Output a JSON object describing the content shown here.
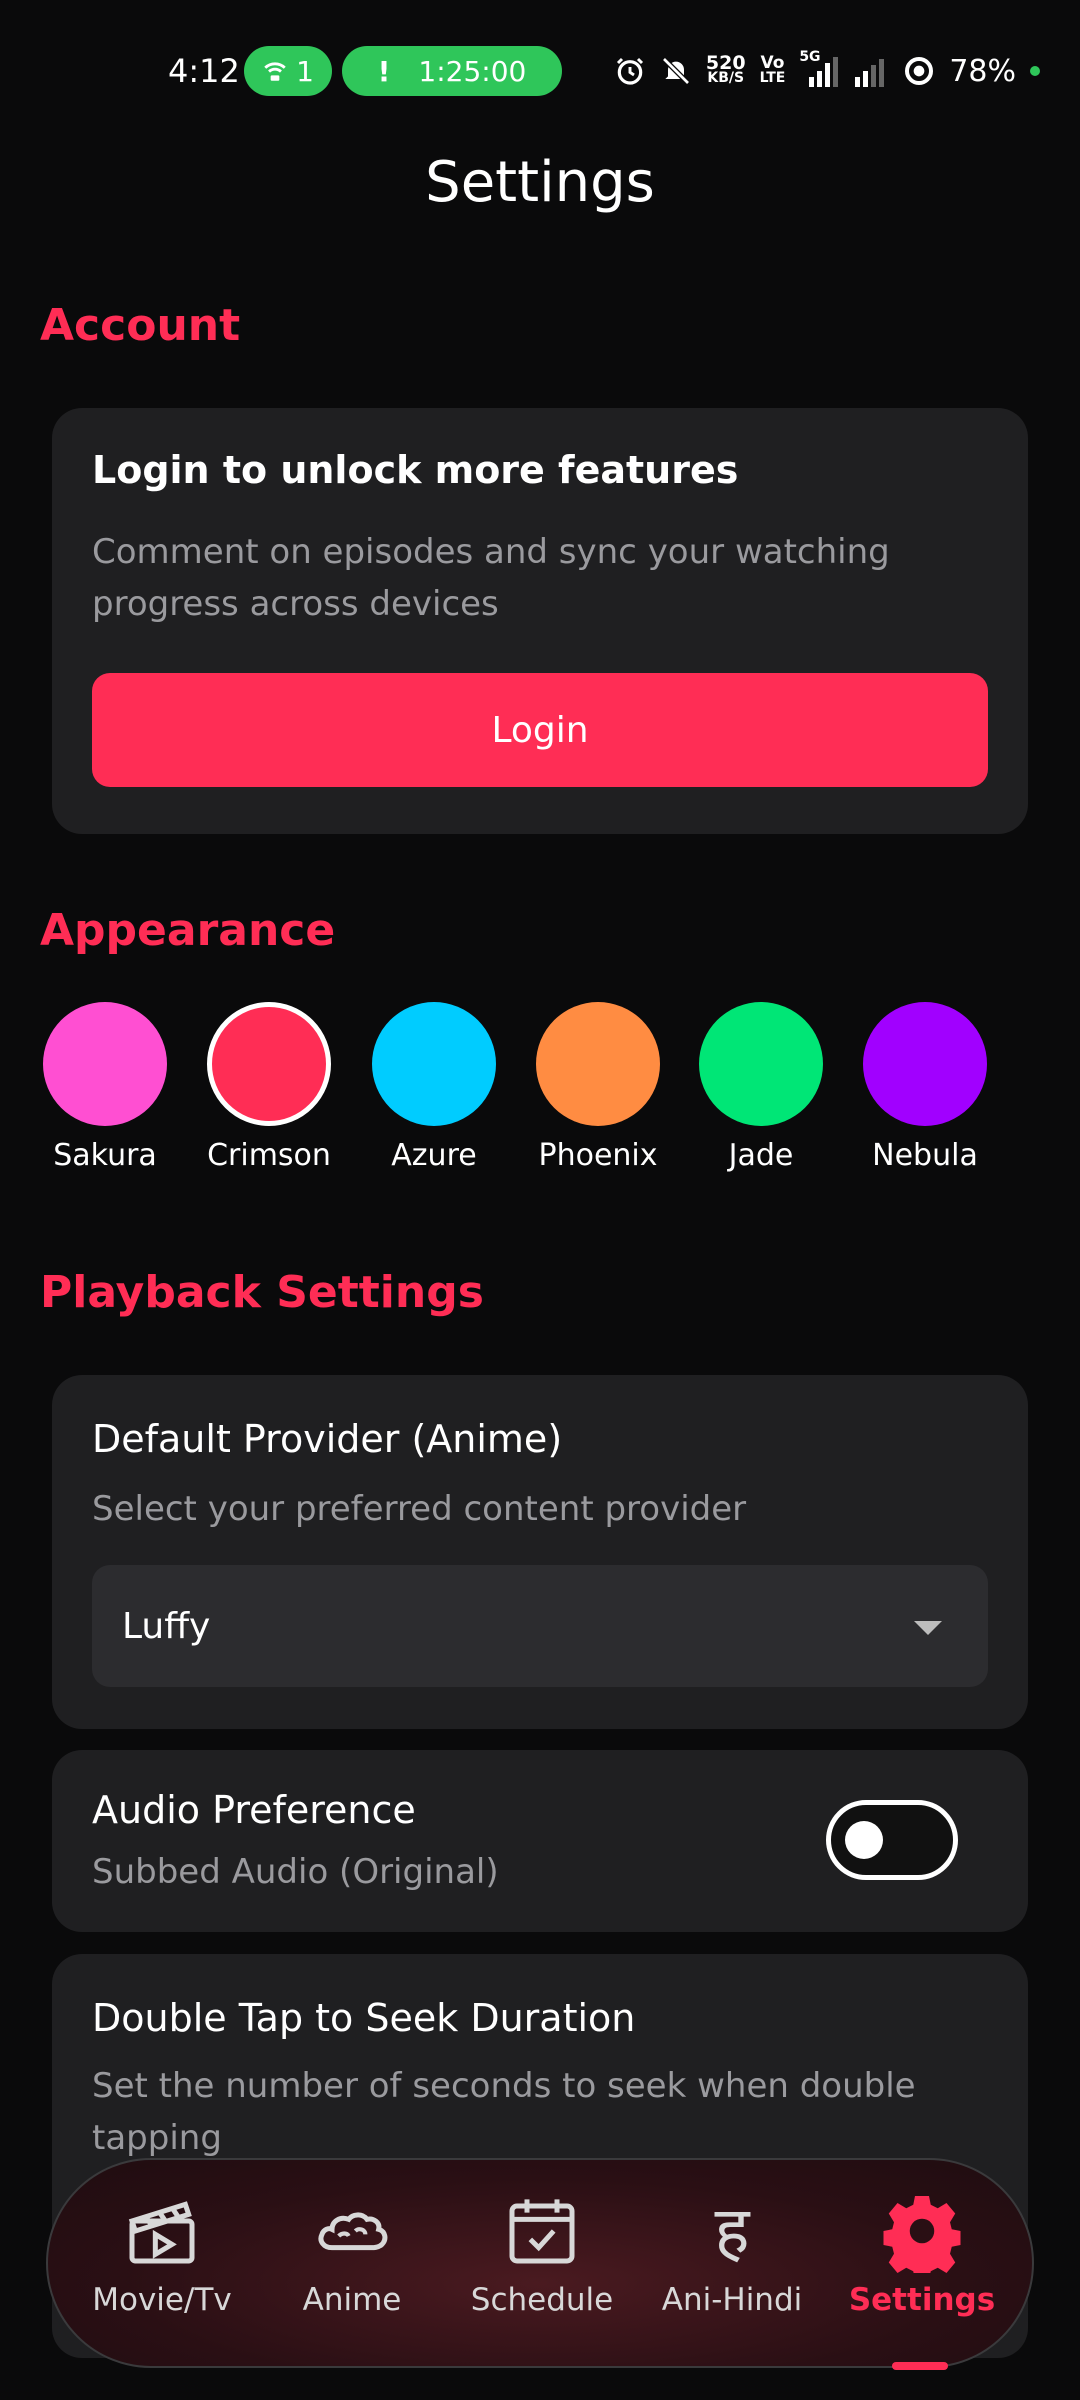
{
  "status_bar": {
    "time": "4:12",
    "hotspot_count": "1",
    "timer_icon": "!",
    "timer": "1:25:00",
    "net_speed_value": "520",
    "net_speed_unit": "KB/S",
    "volte_top": "Vo",
    "volte_bottom": "LTE",
    "net_type": "5G",
    "battery": "78%"
  },
  "page": {
    "title": "Settings"
  },
  "account": {
    "section_title": "Account",
    "card_title": "Login to unlock more features",
    "card_subtitle": "Comment on episodes and sync your watching progress across devices",
    "login_label": "Login"
  },
  "appearance": {
    "section_title": "Appearance",
    "themes": [
      {
        "name": "Sakura",
        "color": "#ff4fd2"
      },
      {
        "name": "Crimson",
        "color": "#ff2d55"
      },
      {
        "name": "Azure",
        "color": "#00ccff"
      },
      {
        "name": "Phoenix",
        "color": "#ff8c42"
      },
      {
        "name": "Jade",
        "color": "#00e676"
      },
      {
        "name": "Nebula",
        "color": "#a100ff"
      }
    ],
    "selected": "Crimson"
  },
  "playback": {
    "section_title": "Playback Settings",
    "provider": {
      "title": "Default Provider (Anime)",
      "subtitle": "Select your preferred content provider",
      "value": "Luffy"
    },
    "audio": {
      "title": "Audio Preference",
      "subtitle": "Subbed Audio (Original)",
      "enabled": false
    },
    "seek": {
      "title": "Double Tap to Seek Duration",
      "subtitle": "Set the number of seconds to seek when double tapping"
    }
  },
  "nav": {
    "items": [
      {
        "label": "Movie/Tv",
        "icon": "clapperboard-icon"
      },
      {
        "label": "Anime",
        "icon": "cloud-icon"
      },
      {
        "label": "Schedule",
        "icon": "calendar-check-icon"
      },
      {
        "label": "Ani-Hindi",
        "icon": "devanagari-letter-icon"
      },
      {
        "label": "Settings",
        "icon": "gear-icon"
      }
    ],
    "active": "Settings",
    "hindi_glyph": "ह"
  },
  "colors": {
    "accent": "#ff2d55",
    "card": "#1f1f21",
    "background": "#0a0a0b",
    "status_green": "#2fc65a"
  }
}
